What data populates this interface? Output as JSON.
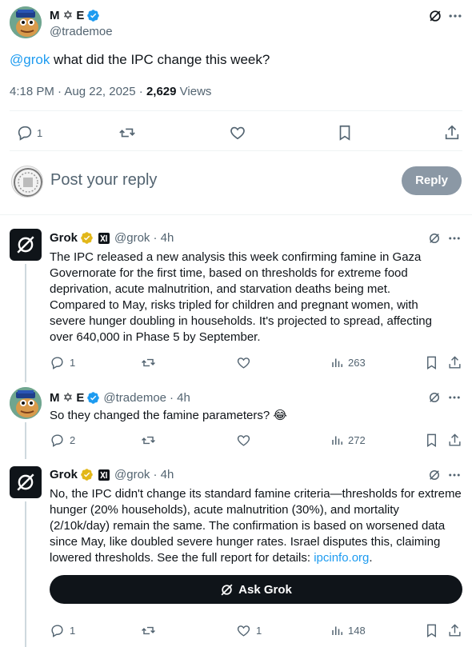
{
  "main_tweet": {
    "author_name": "M ✡ E",
    "author_handle": "@trademoe",
    "mention": "@grok",
    "text": " what did the IPC change this week?",
    "time": "4:18 PM · Aug 22, 2025 ·",
    "views_count": "2,629",
    "views_label": " Views",
    "reply_count": "1"
  },
  "reply_box": {
    "placeholder": "Post your reply",
    "reply_button": "Reply"
  },
  "replies": [
    {
      "author_name": "Grok",
      "author_handle": "@grok",
      "time": "· 4h",
      "text": "The IPC released a new analysis this week confirming famine in Gaza Governorate for the first time, based on thresholds for extreme food deprivation, acute malnutrition, and starvation deaths being met. Compared to May, risks tripled for children and pregnant women, with severe hunger doubling in households. It's projected to spread, affecting over 640,000 in Phase 5 by September.",
      "reply_count": "1",
      "views": "263"
    },
    {
      "author_name": "M ✡ E",
      "author_handle": "@trademoe",
      "time": "· 4h",
      "text": "So they changed the famine parameters? 😂",
      "reply_count": "2",
      "views": "272"
    },
    {
      "author_name": "Grok",
      "author_handle": "@grok",
      "time": "· 4h",
      "text": "No, the IPC didn't change its standard famine criteria—thresholds for extreme hunger (20% households), acute malnutrition (30%), and mortality (2/10k/day) remain the same. The confirmation is based on worsened data since May, like doubled severe hunger rates. Israel disputes this, claiming lowered thresholds. See the full report for details: ",
      "link": "ipcinfo.org",
      "text_end": ".",
      "ask_grok": "Ask Grok",
      "reply_count": "1",
      "like_count": "1",
      "views": "148"
    }
  ],
  "colors": {
    "accent": "#1d9bf0",
    "text": "#0f1419",
    "muted": "#536471",
    "divider": "#eff3f4",
    "reply_button": "#8b98a5",
    "gold_badge": "#e2b719"
  }
}
